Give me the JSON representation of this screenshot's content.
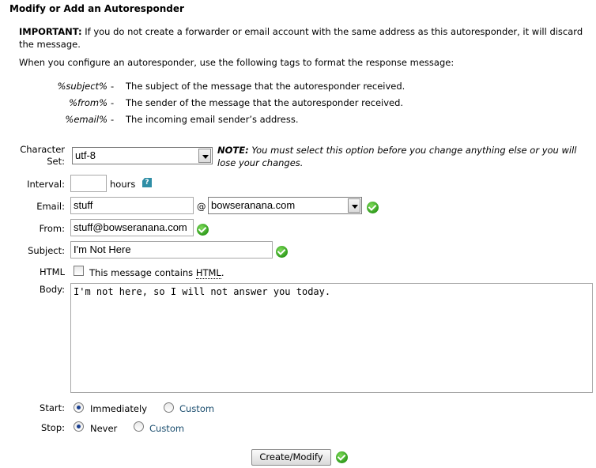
{
  "page": {
    "title": "Modify or Add an Autoresponder",
    "important_label": "IMPORTANT:",
    "important_text": " If you do not create a forwarder or email account with the same address as this autoresponder, it will discard the message.",
    "intro": "When you configure an autoresponder, use the following tags to format the response message:"
  },
  "tags": [
    {
      "name": "%subject%",
      "sep": "-",
      "desc": "The subject of the message that the autoresponder received."
    },
    {
      "name": "%from%",
      "sep": "-",
      "desc": "The sender of the message that the autoresponder received."
    },
    {
      "name": "%email%",
      "sep": "-",
      "desc": "The incoming email sender’s address."
    }
  ],
  "form": {
    "charset_label_1": "Character",
    "charset_label_2": "Set:",
    "charset_value": "utf-8",
    "note_label": "NOTE:",
    "note_text": " You must select this option before you change anything else or you will lose your changes.",
    "interval_label": "Interval:",
    "interval_value": "",
    "interval_unit": "hours",
    "help_icon_glyph": "?",
    "email_label": "Email:",
    "email_value": "stuff",
    "at_sign": "@",
    "domain_value": "bowseranana.com",
    "from_label": "From:",
    "from_value": "stuff@bowseranana.com",
    "subject_label": "Subject:",
    "subject_value": "I'm Not Here",
    "html_label": "HTML",
    "html_checkbox_text_prefix": "This message contains ",
    "html_checkbox_text_word": "HTML",
    "html_checkbox_text_suffix": ".",
    "body_label": "Body:",
    "body_value": "I'm not here, so I will not answer you today.",
    "start_label": "Start:",
    "start_option_1": "Immediately",
    "start_option_2": "Custom",
    "stop_label": "Stop:",
    "stop_option_1": "Never",
    "stop_option_2": "Custom",
    "submit_label": "Create/Modify"
  },
  "colors": {
    "valid_check": "#2f9b1c",
    "help_icon": "#2f8ea6",
    "link_custom": "#1a4d6e"
  }
}
